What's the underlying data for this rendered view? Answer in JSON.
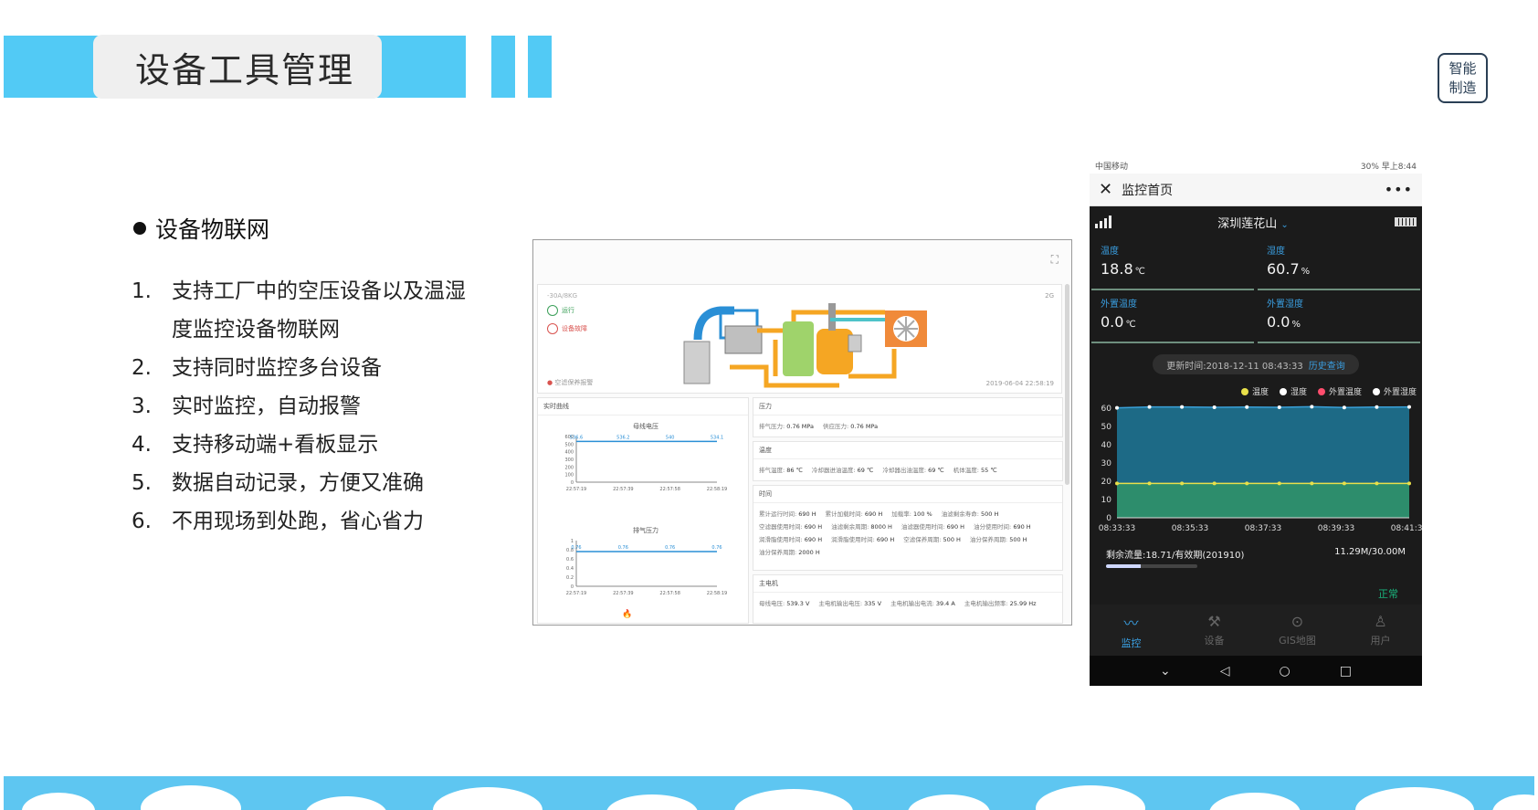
{
  "slide": {
    "title": "设备工具管理",
    "badge_line1": "智能",
    "badge_line2": "制造"
  },
  "content": {
    "heading": "设备物联网",
    "items": [
      {
        "num": "1.",
        "text": "支持工厂中的空压设备以及温湿度监控设备物联网"
      },
      {
        "num": "2.",
        "text": "支持同时监控多台设备"
      },
      {
        "num": "3.",
        "text": "实时监控，自动报警"
      },
      {
        "num": "4.",
        "text": "支持移动端+看板显示"
      },
      {
        "num": "5.",
        "text": "数据自动记录，方便又准确"
      },
      {
        "num": "6.",
        "text": "不用现场到处跑，省心省力"
      }
    ]
  },
  "dashboard": {
    "device": "-30A/8KG",
    "status_run": "运行",
    "status_fault": "设备故障",
    "alarm": "空滤保养报警",
    "net": "2G",
    "timestamp": "2019-06-04 22:58:19",
    "realtime_label": "实时曲线",
    "chart1_title": "母线电压",
    "chart1_labels": [
      "536.6",
      "536.2",
      "540",
      "534.1"
    ],
    "chart1_yticks": [
      "600",
      "500",
      "400",
      "300",
      "200",
      "100",
      "0"
    ],
    "chart1_xticks": [
      "22:57:19",
      "22:57:39",
      "22:57:58",
      "22:58:19"
    ],
    "chart2_title": "排气压力",
    "chart2_labels": [
      "0.76",
      "0.76",
      "0.76",
      "0.76"
    ],
    "chart2_yticks": [
      "1",
      "0.8",
      "0.6",
      "0.4",
      "0.2",
      "0"
    ],
    "chart2_xticks": [
      "22:57:19",
      "22:57:39",
      "22:57:58",
      "22:58:19"
    ],
    "pressure": {
      "title": "压力",
      "items": [
        {
          "k": "排气压力:",
          "v": "0.76 MPa"
        },
        {
          "k": "供应压力:",
          "v": "0.76 MPa"
        }
      ]
    },
    "temperature": {
      "title": "温度",
      "items": [
        {
          "k": "排气温度:",
          "v": "86 ℃"
        },
        {
          "k": "冷却器进油温度:",
          "v": "69 ℃"
        },
        {
          "k": "冷却器出油温度:",
          "v": "69 ℃"
        },
        {
          "k": "机体温度:",
          "v": "55 ℃"
        }
      ]
    },
    "time": {
      "title": "时间",
      "items": [
        {
          "k": "累计运行时间:",
          "v": "690 H"
        },
        {
          "k": "累计加载时间:",
          "v": "690 H"
        },
        {
          "k": "加载率:",
          "v": "100 %"
        },
        {
          "k": "油滤剩余寿命:",
          "v": "500 H"
        },
        {
          "k": "空滤器使用时间:",
          "v": "690 H"
        },
        {
          "k": "油滤剩余周期:",
          "v": "8000 H"
        },
        {
          "k": "油滤器使用时间:",
          "v": "690 H"
        },
        {
          "k": "油分使用时间:",
          "v": "690 H"
        },
        {
          "k": "润滑脂使用时间:",
          "v": "690 H"
        },
        {
          "k": "润滑脂使用时间:",
          "v": "690 H"
        },
        {
          "k": "空滤保养周期:",
          "v": "500 H"
        },
        {
          "k": "油分保养周期:",
          "v": "500 H"
        },
        {
          "k": "油分保养周期:",
          "v": "2000 H"
        }
      ]
    },
    "motor": {
      "title": "主电机",
      "items": [
        {
          "k": "母线电压:",
          "v": "539.3 V"
        },
        {
          "k": "主电机输出电压:",
          "v": "335 V"
        },
        {
          "k": "主电机输出电流:",
          "v": "39.4 A"
        },
        {
          "k": "主电机输出频率:",
          "v": "25.99 Hz"
        }
      ]
    }
  },
  "phone": {
    "carrier": "中国移动",
    "status_right": "30% 早上8:44",
    "nav_title": "监控首页",
    "location": "深圳莲花山",
    "cells": [
      {
        "label": "温度",
        "value": "18.8",
        "unit": "℃"
      },
      {
        "label": "湿度",
        "value": "60.7",
        "unit": "%"
      },
      {
        "label": "外置温度",
        "value": "0.0",
        "unit": "℃"
      },
      {
        "label": "外置湿度",
        "value": "0.0",
        "unit": "%"
      }
    ],
    "update_text": "更新时间:2018-12-11 08:43:33",
    "history_link": "历史查询",
    "legend": [
      {
        "name": "温度",
        "color": "#e8e04a"
      },
      {
        "name": "湿度",
        "color": "#ffffff"
      },
      {
        "name": "外置温度",
        "color": "#ff4d6d"
      },
      {
        "name": "外置湿度",
        "color": "#ffffff"
      }
    ],
    "flow_label": "剩余流量:18.71/有效期(201910)",
    "flow_value": "11.29M/30.00M",
    "flow_status": "正常",
    "flow_used_fraction": 0.38,
    "tabs": [
      {
        "label": "监控",
        "icon": "chart-icon",
        "active": true
      },
      {
        "label": "设备",
        "icon": "tools-icon",
        "active": false
      },
      {
        "label": "GIS地图",
        "icon": "map-pin-icon",
        "active": false
      },
      {
        "label": "用户",
        "icon": "user-icon",
        "active": false
      }
    ]
  },
  "chart_data": {
    "type": "area",
    "x": [
      "08:33:33",
      "08:35:33",
      "08:37:33",
      "08:39:33",
      "08:41:33"
    ],
    "xlabel": "",
    "ylabel": "",
    "ylim": [
      0,
      60
    ],
    "yticks": [
      0,
      10,
      20,
      30,
      40,
      50,
      60
    ],
    "grid": false,
    "legend_position": "top-right",
    "series": [
      {
        "name": "温度",
        "color": "#e8e04a",
        "values": [
          18.8,
          18.8,
          18.8,
          18.8,
          18.8,
          18.8,
          18.8,
          18.8,
          18.8,
          18.8
        ]
      },
      {
        "name": "湿度",
        "color": "#ffffff",
        "values": [
          60.2,
          60.7,
          60.7,
          60.5,
          60.6,
          60.5,
          60.8,
          60.4,
          60.6,
          60.7
        ]
      }
    ]
  }
}
